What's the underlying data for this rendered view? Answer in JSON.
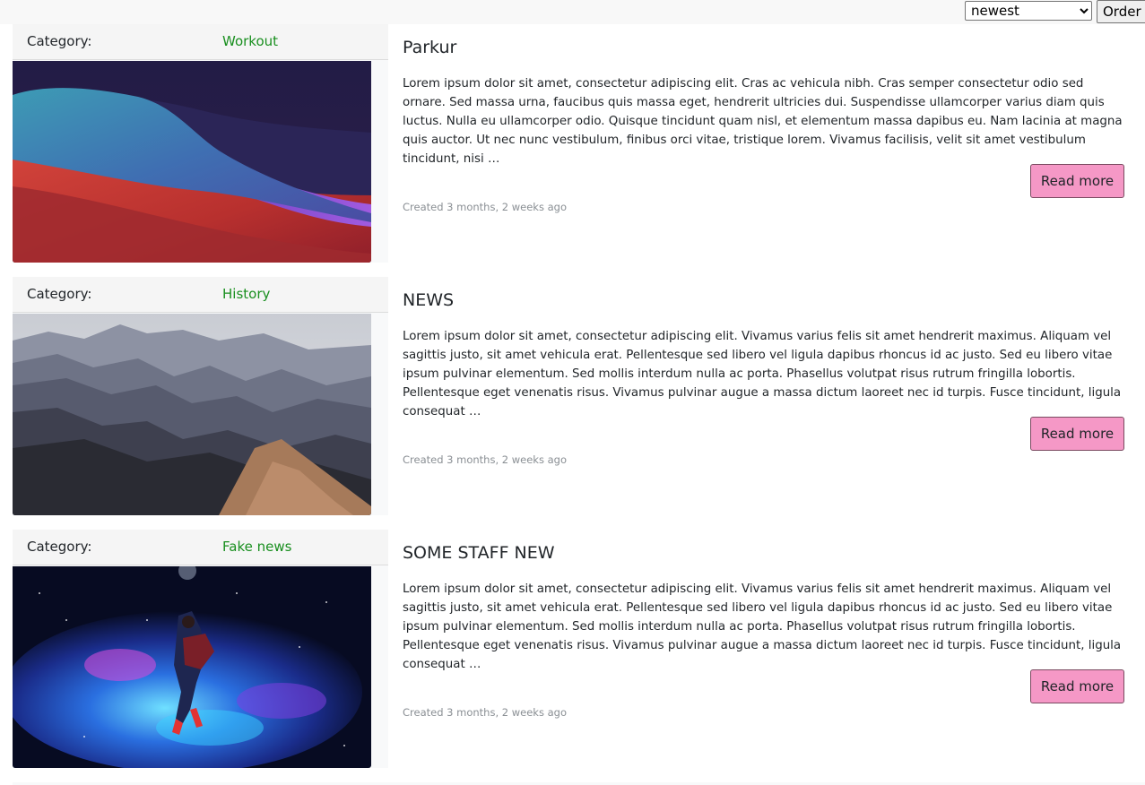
{
  "toolbar": {
    "order_select_value": "newest",
    "order_options": [
      "newest"
    ],
    "order_button_label": "Order"
  },
  "posts": [
    {
      "category_label": "Category:",
      "category": "Workout",
      "category_color": "#198f1f",
      "image": "abstract-waves-image",
      "title": "Parkur",
      "body": "Lorem ipsum dolor sit amet, consectetur adipiscing elit. Cras ac vehicula nibh. Cras semper consectetur odio sed ornare. Sed massa urna, faucibus quis massa eget, hendrerit ultricies dui. Suspendisse ullamcorper varius diam quis luctus. Nulla eu ullamcorper odio. Quisque tincidunt quam nisl, et elementum massa dapibus eu. Nam lacinia at magna quis auctor. Ut nec nunc vestibulum, finibus orci vitae, tristique lorem. Vivamus facilisis, velit sit amet vestibulum tincidunt, nisi …",
      "read_more_label": "Read more",
      "read_more_color": "#f598c6",
      "created": "Created 3 months, 2 weeks ago"
    },
    {
      "category_label": "Category:",
      "category": "History",
      "category_color": "#198f1f",
      "image": "misty-mountains-image",
      "title": "NEWS",
      "body": "Lorem ipsum dolor sit amet, consectetur adipiscing elit. Vivamus varius felis sit amet hendrerit maximus. Aliquam vel sagittis justo, sit amet vehicula erat. Pellentesque sed libero vel ligula dapibus rhoncus id ac justo. Sed eu libero vitae ipsum pulvinar elementum. Sed mollis interdum nulla ac porta. Phasellus volutpat risus rutrum fringilla lobortis. Pellentesque eget venenatis risus. Vivamus pulvinar augue a massa dictum laoreet nec id turpis. Fusce tincidunt, ligula consequat …",
      "read_more_label": "Read more",
      "read_more_color": "#f598c6",
      "created": "Created 3 months, 2 weeks ago"
    },
    {
      "category_label": "Category:",
      "category": "Fake news",
      "category_color": "#198f1f",
      "image": "space-figure-image",
      "title": "SOME STAFF NEW",
      "body": "Lorem ipsum dolor sit amet, consectetur adipiscing elit. Vivamus varius felis sit amet hendrerit maximus. Aliquam vel sagittis justo, sit amet vehicula erat. Pellentesque sed libero vel ligula dapibus rhoncus id ac justo. Sed eu libero vitae ipsum pulvinar elementum. Sed mollis interdum nulla ac porta. Phasellus volutpat risus rutrum fringilla lobortis. Pellentesque eget venenatis risus. Vivamus pulvinar augue a massa dictum laoreet nec id turpis. Fusce tincidunt, ligula consequat …",
      "read_more_label": "Read more",
      "read_more_color": "#f598c6",
      "created": "Created 3 months, 2 weeks ago"
    }
  ]
}
